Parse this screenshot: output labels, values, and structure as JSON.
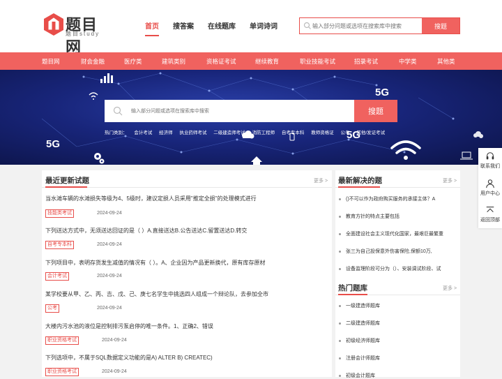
{
  "brand": {
    "name": "题目网",
    "sub": "题目study",
    "accent": "#e84d49"
  },
  "nav": {
    "items": [
      "首页",
      "搜答案",
      "在线题库",
      "单词诗词"
    ]
  },
  "top_search": {
    "placeholder": "输入部分问题或选项在搜索库中搜索",
    "button": "搜题"
  },
  "categories": [
    "题目网",
    "财会金融",
    "医疗类",
    "建筑类别",
    "资格证考试",
    "继续教育",
    "职业技能考试",
    "招录考试",
    "中学类",
    "其他类"
  ],
  "hero": {
    "search_placeholder": "输入部分问题或选项在搜索库中搜索",
    "search_button": "搜题",
    "hot_label": "热门类别：",
    "hot_links": [
      "会计考试",
      "经济师",
      "执业药师考试",
      "二级建造师考试",
      "消防工程师",
      "自考专本科",
      "教师资格证",
      "公考",
      "其他/发证考试"
    ],
    "badges": [
      "5G",
      "5G",
      "5G"
    ]
  },
  "latest": {
    "title": "最近更新试题",
    "more": "更多 >",
    "items": [
      {
        "text": "当水滩车辆的水滩损失等级为4、5级时，建议定损人员采用\"推定全损\"的处理模式进行",
        "tag": "技能类考试",
        "date": "2024-09-24"
      },
      {
        "text": "下列送达方式中，无须送达回证的是（ ）A.直接送达B.公告送达C.留置送达D.转交",
        "tag": "自考专本科",
        "date": "2024-09-24"
      },
      {
        "text": "下列项目中，表明存货发生减值的情况有（ ）。A、企业因为产品更新换代，原有库存原材",
        "tag": "会计考试",
        "date": "2024-09-24"
      },
      {
        "text": "某学校要从甲、乙、丙、吉、戊、己、庚七名学生中挑选四人组成一个辩论队，去参加全市",
        "tag": "公考",
        "date": "2024-09-24"
      },
      {
        "text": "大楼内污水池的液位是控制排污泵启停的唯一条件。1、正确2、错误",
        "tag": "职业资格考试",
        "date": "2024-09-24"
      },
      {
        "text": "下列选项中，不属于SQL数据定义功能的是A) ALTER B) CREATEC)",
        "tag": "职业资格考试",
        "date": "2024-09-24"
      }
    ]
  },
  "solved": {
    "title": "最新解决的题",
    "more": "更多 >",
    "items": [
      "()不可以作为政府购买服务的承接主体？A",
      "教育方针的特点主要包括",
      "全面建设社会主义现代化国家，最艰巨最繁重",
      "张三为自己投保意外伤害保险,保额10万,",
      "设备监理阶段可分为（）、安装调试阶段、试"
    ]
  },
  "hot_banks": {
    "title": "热门题库",
    "more": "更多 >",
    "items": [
      "一级建造师题库",
      "二级建造师题库",
      "初级经济师题库",
      "注册会计师题库",
      "初级会计题库"
    ]
  },
  "float_bar": {
    "items": [
      "联系我们",
      "用户中心",
      "返回顶部"
    ]
  }
}
